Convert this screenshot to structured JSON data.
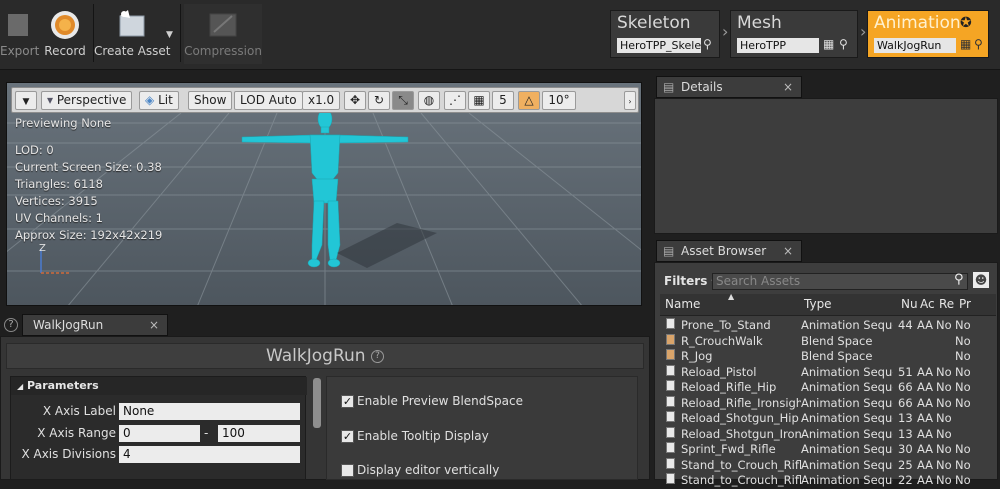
{
  "toolbar": {
    "export_label": "Export",
    "record_label": "Record",
    "create_asset_label": "Create Asset",
    "compression_label": "Compression"
  },
  "breadcrumbs": [
    {
      "title": "Skeleton",
      "value": "HeroTPP_Skeleton"
    },
    {
      "title": "Mesh",
      "value": "HeroTPP"
    },
    {
      "title": "Animation",
      "value": "WalkJogRun"
    }
  ],
  "viewport": {
    "perspective_label": "Perspective",
    "lit_label": "Lit",
    "show_label": "Show",
    "lod_label": "LOD Auto",
    "speed_label": "x1.0",
    "grid_value": "5",
    "angle_value": "10°",
    "previewing": "Previewing None",
    "stats": [
      "LOD: 0",
      "Current Screen Size: 0.38",
      "Triangles: 6118",
      "Vertices: 3915",
      "UV Channels: 1",
      "Approx Size: 192x42x219"
    ],
    "axis_z": "Z",
    "mesh_color": "#22c6d6"
  },
  "details": {
    "tab_label": "Details"
  },
  "asset_browser": {
    "tab_label": "Asset Browser",
    "filters_label": "Filters",
    "search_placeholder": "Search Assets",
    "columns": [
      "Name",
      "Type",
      "Nu",
      "Ac",
      "Re",
      "Pr"
    ],
    "rows": [
      {
        "name": "Prone_To_Stand",
        "type": "Animation Sequence",
        "nu": "44",
        "ac": "AA",
        "re": "No",
        "pr": "No",
        "icon": "anim"
      },
      {
        "name": "R_CrouchWalk",
        "type": "Blend Space",
        "nu": "",
        "ac": "",
        "re": "",
        "pr": "No",
        "icon": "blend"
      },
      {
        "name": "R_Jog",
        "type": "Blend Space",
        "nu": "",
        "ac": "",
        "re": "",
        "pr": "No",
        "icon": "blend"
      },
      {
        "name": "Reload_Pistol",
        "type": "Animation Sequence",
        "nu": "51",
        "ac": "AA",
        "re": "No",
        "pr": "No",
        "icon": "anim"
      },
      {
        "name": "Reload_Rifle_Hip",
        "type": "Animation Sequence",
        "nu": "66",
        "ac": "AA",
        "re": "No",
        "pr": "No",
        "icon": "anim"
      },
      {
        "name": "Reload_Rifle_Ironsights",
        "type": "Animation Sequence",
        "nu": "66",
        "ac": "AA",
        "re": "No",
        "pr": "No",
        "icon": "anim"
      },
      {
        "name": "Reload_Shotgun_Hip",
        "type": "Animation Sequence",
        "nu": "13",
        "ac": "AA",
        "re": "No",
        "pr": "",
        "icon": "anim"
      },
      {
        "name": "Reload_Shotgun_Ironsights",
        "type": "Animation Sequence",
        "nu": "13",
        "ac": "AA",
        "re": "No",
        "pr": "",
        "icon": "anim"
      },
      {
        "name": "Sprint_Fwd_Rifle",
        "type": "Animation Sequence",
        "nu": "30",
        "ac": "AA",
        "re": "No",
        "pr": "No",
        "icon": "anim"
      },
      {
        "name": "Stand_to_Crouch_Rifle",
        "type": "Animation Sequence",
        "nu": "25",
        "ac": "AA",
        "re": "No",
        "pr": "No",
        "icon": "anim"
      },
      {
        "name": "Stand_to_Crouch_Rifle",
        "type": "Animation Sequence",
        "nu": "22",
        "ac": "AA",
        "re": "No",
        "pr": "No",
        "icon": "anim"
      }
    ]
  },
  "editor": {
    "tab_label": "WalkJogRun",
    "title": "WalkJogRun",
    "parameters_label": "Parameters",
    "x_axis_label_label": "X Axis Label",
    "x_axis_label_value": "None",
    "x_axis_range_label": "X Axis Range",
    "x_axis_range_min": "0",
    "x_axis_range_sep": "-",
    "x_axis_range_max": "100",
    "x_axis_divisions_label": "X Axis Divisions",
    "x_axis_divisions_value": "4",
    "enable_preview_label": "Enable Preview BlendSpace",
    "enable_tooltip_label": "Enable Tooltip Display",
    "third_option_label": "Display editor vertically"
  }
}
